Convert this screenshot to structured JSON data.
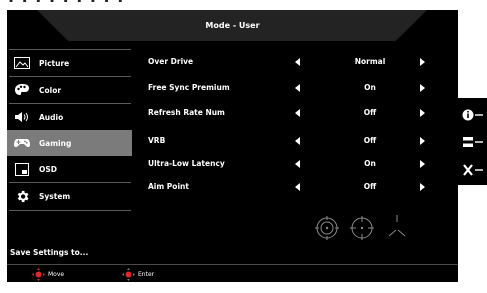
{
  "title": "Mode - User",
  "menu": [
    {
      "label": "Picture",
      "icon": "picture-icon",
      "active": false
    },
    {
      "label": "Color",
      "icon": "color-palette-icon",
      "active": false
    },
    {
      "label": "Audio",
      "icon": "speaker-icon",
      "active": false
    },
    {
      "label": "Gaming",
      "icon": "gamepad-icon",
      "active": true
    },
    {
      "label": "OSD",
      "icon": "osd-icon",
      "active": false
    },
    {
      "label": "System",
      "icon": "gear-icon",
      "active": false
    }
  ],
  "save_settings": "Save Settings to...",
  "settings": [
    {
      "name": "Over Drive",
      "value": "Normal"
    },
    {
      "name": "Free Sync Premium",
      "value": "On"
    },
    {
      "name": "Refresh Rate Num",
      "value": "Off"
    },
    {
      "name": "VRB",
      "value": "Off"
    },
    {
      "name": "Ultra-Low Latency",
      "value": "On"
    },
    {
      "name": "Aim Point",
      "value": "Off"
    }
  ],
  "footer": {
    "move": "Move",
    "enter": "Enter"
  },
  "colors": {
    "osd_bg": "#000000",
    "active_menu": "#7b7b7b",
    "accent": "#e0282b"
  }
}
